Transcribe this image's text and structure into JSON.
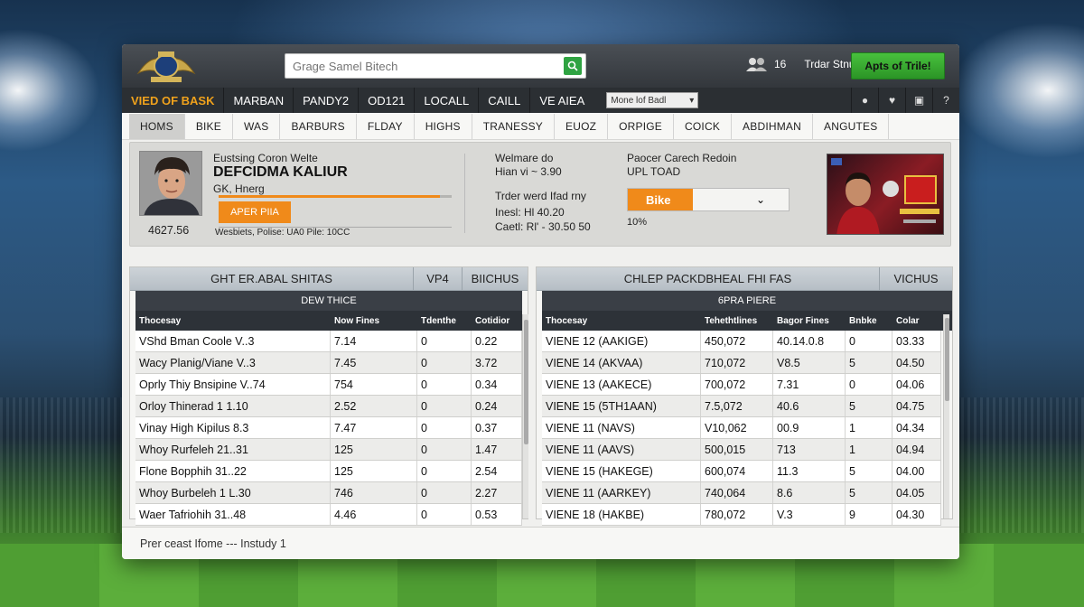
{
  "header": {
    "search_placeholder": "Grage Samel Bitech",
    "user_label": "Trdar Stnue",
    "user_count": "16",
    "cta_label": "Apts of Trile!"
  },
  "nav": {
    "brand": "VIED OF BASK",
    "items": [
      "MARBAN",
      "PANDY2",
      "OD121",
      "LOCALL",
      "CAILL",
      "VE AIEA"
    ],
    "select_value": "Mone lof Badl",
    "icons": [
      "apple-icon",
      "heart-icon",
      "lock-icon",
      "help-icon"
    ]
  },
  "tabs": [
    "HOMS",
    "BIKE",
    "WAS",
    "BARBURS",
    "FLDAY",
    "HIGHS",
    "TRANESSY",
    "EUOZ",
    "ORPIGE",
    "COICK",
    "ABDIHMAN",
    "ANGUTES"
  ],
  "profile": {
    "line1": "Eustsing Coron Welte",
    "name": "DEFCIDMA KALIUR",
    "sub": "GK, Hnerg",
    "button_label": "APER PIIA",
    "progress_pct": 95,
    "amount": "4627.56",
    "website": "Wesbiets, Polise: UA0 Pile: 10CC",
    "mid_line1": "Welmare do",
    "mid_line2": "Hian vi ~ 3.90",
    "mid_line3": "Trder werd Ifad rny",
    "mid_line4": "Inesl: Hl 40.20",
    "mid_line5": "Caetl: Rl' - 30.50 50",
    "right_line1": "Paocer Carech Redoin",
    "right_line2": "UPL TOAD",
    "dropdown_value": "Bike",
    "dropdown_pct": "10%"
  },
  "left_table": {
    "title": "GHT ER.ABAL SHITAS",
    "head_col2": "VP4",
    "head_col3": "BIICHUS",
    "sub_title": "DEW THICE",
    "columns": [
      "Thocesay",
      "Now Fines",
      "Tdenthe",
      "Cotidior"
    ],
    "rows": [
      [
        "VShd Bman Coole V..3",
        "7.14",
        "0",
        "0.22"
      ],
      [
        "Wacy Planig/Viane V..3",
        "7.45",
        "0",
        "3.72"
      ],
      [
        "Oprly Thiy Bnsipine V..74",
        "754",
        "0",
        "0.34"
      ],
      [
        "Orloy Thinerad 1 1.10",
        "2.52",
        "0",
        "0.24"
      ],
      [
        "Vinay High Kipilus 8.3",
        "7.47",
        "0",
        "0.37"
      ],
      [
        "Whoy Rurfeleh 21..31",
        "125",
        "0",
        "1.47"
      ],
      [
        "Flone Bopphih 31..22",
        "125",
        "0",
        "2.54"
      ],
      [
        "Whoy Burbeleh 1 L.30",
        "746",
        "0",
        "2.27"
      ],
      [
        "Waer Tafriohih 31..48",
        "4.46",
        "0",
        "0.53"
      ]
    ]
  },
  "right_table": {
    "title": "CHLEP PACKDBHEAL FHI FAS",
    "head_col2": "VICHUS",
    "sub_title": "6PRA PIERE",
    "columns": [
      "Thocesay",
      "Tehethtlines",
      "Bagor Fines",
      "Bnbke",
      "Colar"
    ],
    "rows": [
      [
        "VIENE 12 (AAKIGE)",
        "450,072",
        "40.14.0.8",
        "0",
        "03.33"
      ],
      [
        "VIENE 14 (AKVAA)",
        "710,072",
        "V8.5",
        "5",
        "04.50"
      ],
      [
        "VIENE 13 (AAKECE)",
        "700,072",
        "7.31",
        "0",
        "04.06"
      ],
      [
        "VIENE 15 (5TH1AAN)",
        "7.5,072",
        "40.6",
        "5",
        "04.75"
      ],
      [
        "VIENE 11 (NAVS)",
        "V10,062",
        "00.9",
        "1",
        "04.34"
      ],
      [
        "VIENE 11 (AAVS)",
        "500,015",
        "713",
        "1",
        "04.94"
      ],
      [
        "VIENE 15 (HAKEGE)",
        "600,074",
        "11.3",
        "5",
        "04.00"
      ],
      [
        "VIENE 11 (AARKEY)",
        "740,064",
        "8.6",
        "5",
        "04.05"
      ],
      [
        "VIENE 18 (HAKBE)",
        "780,072",
        "V.3",
        "9",
        "04.30"
      ]
    ]
  },
  "footer": {
    "status": "Prer ceast Ifome --- Instudy 1"
  },
  "colors": {
    "accent_orange": "#f08a1a",
    "cta_green": "#2fa342",
    "nav_dark": "#2b2f33"
  }
}
